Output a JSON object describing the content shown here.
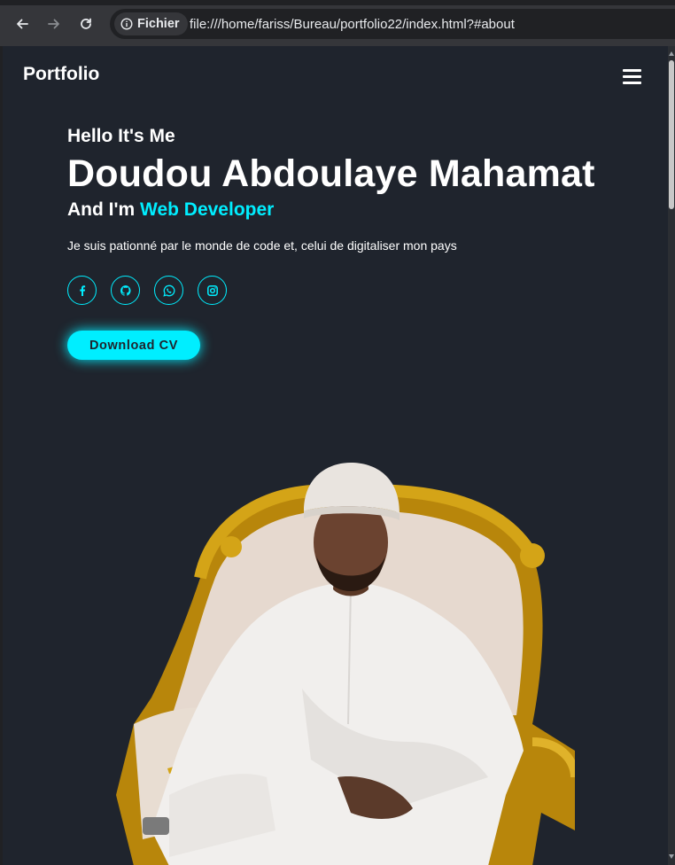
{
  "browser": {
    "site_info_label": "Fichier",
    "url": "file:///home/fariss/Bureau/portfolio22/index.html?#about"
  },
  "nav": {
    "logo": "Portfolio"
  },
  "hero": {
    "greeting": "Hello It's Me",
    "name": "Doudou Abdoulaye Mahamat",
    "role_prefix": "And I'm ",
    "role_highlight": "Web Developer",
    "tagline": "Je suis pationné par le monde de code et, celui de digitaliser mon pays",
    "cta_label": "Download CV"
  },
  "socials": [
    {
      "icon": "facebook-icon"
    },
    {
      "icon": "github-icon"
    },
    {
      "icon": "whatsapp-icon"
    },
    {
      "icon": "instagram-icon"
    }
  ],
  "colors": {
    "accent": "#00eeff",
    "page_background": "#1f242d",
    "text": "#ffffff"
  }
}
